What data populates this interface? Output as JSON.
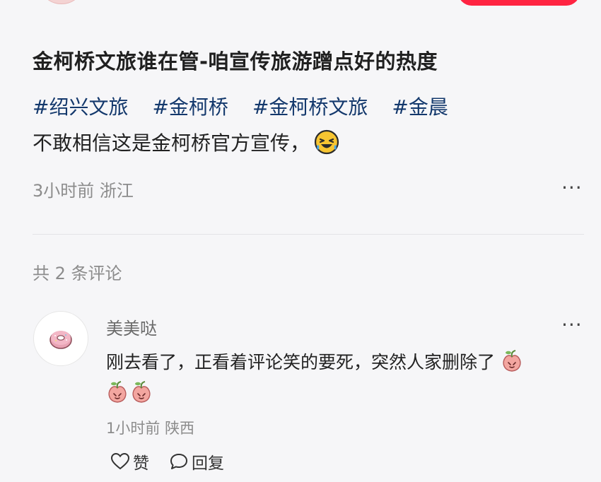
{
  "post": {
    "title": "金柯桥文旅谁在管-咱宣传旅游蹭点好的热度",
    "tags": [
      "#绍兴文旅",
      "#金柯桥",
      "#金柯桥文旅",
      "#金晨"
    ],
    "body": "不敢相信这是金柯桥官方宣传，",
    "time": "3小时前",
    "location": "浙江"
  },
  "comments_header": {
    "text": "共 2 条评论"
  },
  "comment": {
    "username": "美美哒",
    "text": "刚去看了，正看着评论笑的要死，突然人家删除了",
    "time": "1小时前",
    "location": "陕西",
    "like_label": "赞",
    "reply_label": "回复"
  },
  "icons": {
    "post_emoji": "laughing-crying-emoji",
    "comment_emoji": "peach-emoji",
    "like": "heart-outline-icon",
    "reply": "speech-bubble-icon",
    "more": "ellipsis-icon"
  },
  "colors": {
    "accent": "#ff2442",
    "tag": "#13386c",
    "meta": "#8c8c8c",
    "background": "#f6f6f8"
  }
}
